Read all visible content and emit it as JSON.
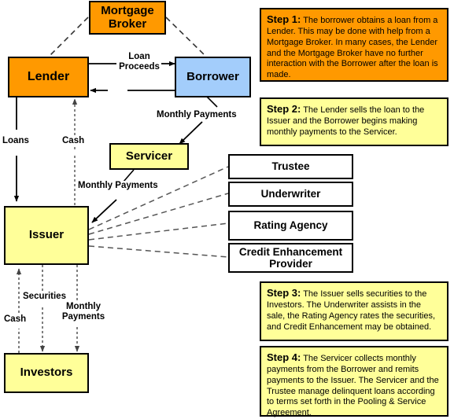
{
  "diagram": {
    "title": "Mortgage Securitization Process",
    "colors": {
      "orange": "#ff9900",
      "blue": "#a3cdfb",
      "yellow": "#ffff99",
      "white": "#ffffff",
      "line": "#000000",
      "dashed_line": "#555555"
    },
    "nodes": [
      {
        "id": "mortgage-broker",
        "label": "Mortgage Broker",
        "fill": "orange"
      },
      {
        "id": "lender",
        "label": "Lender",
        "fill": "orange"
      },
      {
        "id": "borrower",
        "label": "Borrower",
        "fill": "blue"
      },
      {
        "id": "servicer",
        "label": "Servicer",
        "fill": "yellow"
      },
      {
        "id": "issuer",
        "label": "Issuer",
        "fill": "yellow"
      },
      {
        "id": "investors",
        "label": "Investors",
        "fill": "yellow"
      },
      {
        "id": "trustee",
        "label": "Trustee",
        "fill": "white"
      },
      {
        "id": "underwriter",
        "label": "Underwriter",
        "fill": "white"
      },
      {
        "id": "rating-agency",
        "label": "Rating Agency",
        "fill": "white"
      },
      {
        "id": "credit-enhancement-provider",
        "label": "Credit Enhancement Provider",
        "fill": "white"
      }
    ],
    "edge_labels": [
      {
        "id": "loan-proceeds",
        "text_line1": "Loan",
        "text_line2": "Proceeds"
      },
      {
        "id": "monthly-payments-borrower",
        "text_line1": "Monthly Payments",
        "text_line2": ""
      },
      {
        "id": "loans",
        "text_line1": "Loans",
        "text_line2": ""
      },
      {
        "id": "cash-lender",
        "text_line1": "Cash",
        "text_line2": ""
      },
      {
        "id": "monthly-payments-servicer",
        "text_line1": "Monthly Payments",
        "text_line2": ""
      },
      {
        "id": "cash-investors",
        "text_line1": "Cash",
        "text_line2": ""
      },
      {
        "id": "securities",
        "text_line1": "Securities",
        "text_line2": ""
      },
      {
        "id": "monthly-payments-investors",
        "text_line1": "Monthly",
        "text_line2": "Payments"
      }
    ],
    "callouts": [
      {
        "id": "step-1",
        "step": "Step 1:",
        "body": " The borrower obtains a loan from a Lender. This may be done with help from a Mortgage Broker. In many cases, the Lender and the Mortgage Broker have no further interaction with the Borrower after the loan is made.",
        "fill": "orange"
      },
      {
        "id": "step-2",
        "step": "Step 2:",
        "body": " The Lender sells the loan to the Issuer and the Borrower begins making monthly payments to the Servicer.",
        "fill": "yellow"
      },
      {
        "id": "step-3",
        "step": "Step 3:",
        "body": " The Issuer sells securities to the Investors. The Underwriter assists in the sale, the Rating Agency rates the securities, and Credit Enhancement may be obtained.",
        "fill": "yellow"
      },
      {
        "id": "step-4",
        "step": "Step 4:",
        "body": " The Servicer collects monthly payments from the Borrower and remits payments to the Issuer. The Servicer and the Trustee manage delinquent loans according to terms set forth in the Pooling & Service Agreement.",
        "fill": "yellow"
      }
    ]
  }
}
